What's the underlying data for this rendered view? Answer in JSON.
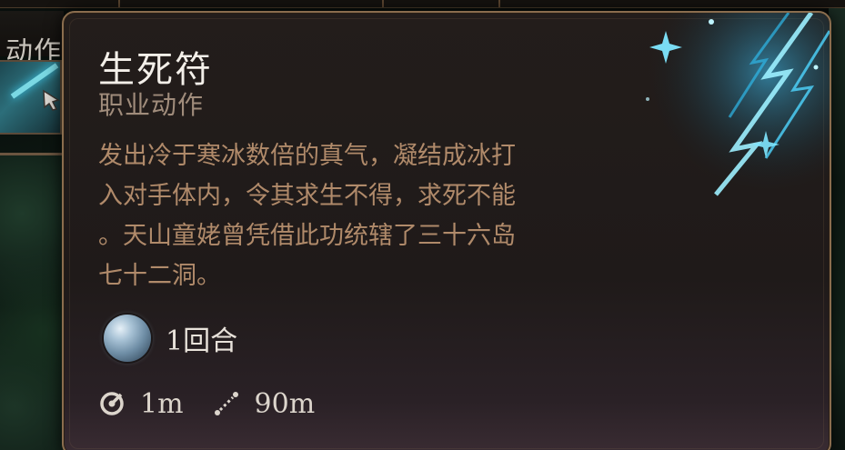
{
  "hud": {
    "actions_tab_label": "动作"
  },
  "tooltip": {
    "title": "生死符",
    "subtitle": "职业动作",
    "description_lines": [
      "发出冷于寒冰数倍的真气，凝结成冰打",
      "入对手体内，令其求生不得，求死不能",
      "。天山童姥曾凭借此功统辖了三十六岛",
      "七十二洞。"
    ],
    "duration": {
      "icon": "frost-orb-icon",
      "text": "1回合"
    },
    "range": {
      "melee_icon": "melee-range-icon",
      "melee_text": "1m",
      "ranged_icon": "ranged-distance-icon",
      "ranged_text": "90m"
    }
  },
  "colors": {
    "border": "#8a6d4e",
    "title": "#f3efe9",
    "subtitle": "#a08c7b",
    "description": "#b08a6a",
    "frost_accent": "#4fd6ff"
  }
}
